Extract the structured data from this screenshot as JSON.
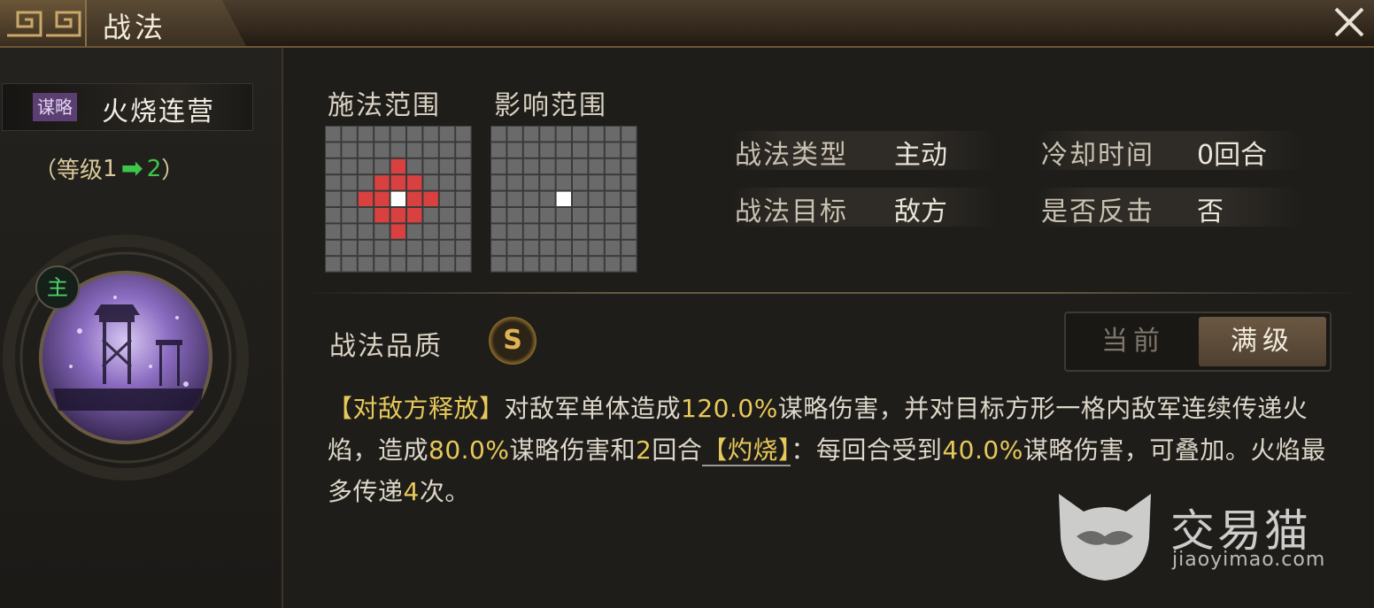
{
  "window": {
    "title": "战法",
    "close_icon": "close-icon"
  },
  "skill": {
    "tag": "谋略",
    "name": "火烧连营",
    "level_open": "（等级",
    "level_from": "1",
    "level_to": "2",
    "level_close": "）",
    "main_badge": "主"
  },
  "ranges": {
    "cast_label": "施法范围",
    "effect_label": "影响范围",
    "cast_color": "#d94040",
    "center_color": "#ffffff",
    "cell_color": "#6a6a6a"
  },
  "info": {
    "type_label": "战法类型",
    "type_value": "主动",
    "cooldown_label": "冷却时间",
    "cooldown_value": "0回合",
    "target_label": "战法目标",
    "target_value": "敌方",
    "counter_label": "是否反击",
    "counter_value": "否"
  },
  "quality": {
    "label": "战法品质",
    "grade": "S"
  },
  "toggle": {
    "current": "当前",
    "max": "满级",
    "selected": "满级"
  },
  "description": {
    "p1": "【对敌方释放】",
    "p2": "对敌军单体造成",
    "p3": "120.0%",
    "p4": "谋略伤害，并对目标方形一格内敌军连续传递火焰，造成",
    "p5": "80.0%",
    "p6": "谋略伤害和",
    "p7": "2",
    "p8": "回合",
    "p9": "【灼烧】",
    "p10": "：每回合受到",
    "p11": "40.0%",
    "p12": "谋略伤害，可叠加。火焰最多传递",
    "p13": "4",
    "p14": "次。"
  },
  "watermark": {
    "brand": "交易猫",
    "url": "jiaoyimao.com"
  }
}
